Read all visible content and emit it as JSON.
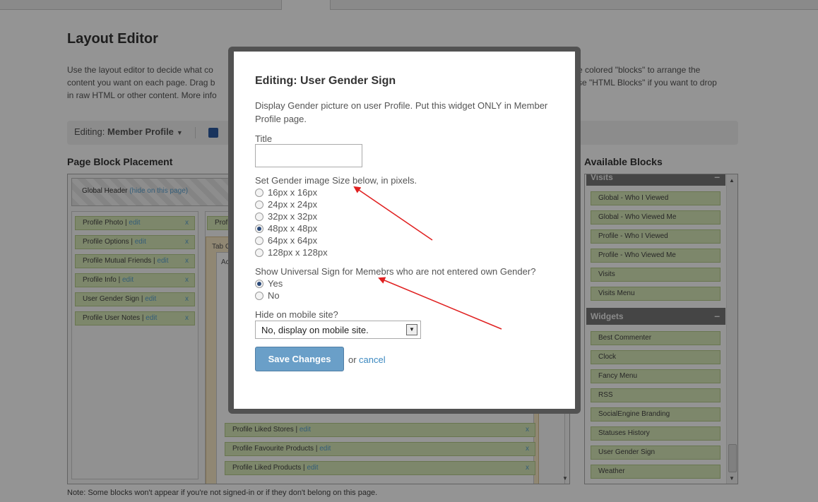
{
  "page": {
    "title": "Layout Editor",
    "intro_line1": "Use the layout editor to decide what co",
    "intro_line1b": "e colored \"blocks\" to arrange the",
    "intro_line2": "content you want on each page. Drag b",
    "intro_line2b": "se \"HTML Blocks\" if you want to drop",
    "intro_line3": "in raw HTML or other content. More info",
    "editing_prefix": "Editing:",
    "editing_page": "Member Profile",
    "placement_title": "Page Block Placement",
    "available_title": "Available Blocks",
    "note": "Note: Some blocks won't appear if you're not signed-in or if they don't belong on this page."
  },
  "placement": {
    "global_header": "Global Header",
    "hide_link": "(hide on this page)",
    "left_blocks": [
      {
        "name": "Profile Photo",
        "edit": "edit"
      },
      {
        "name": "Profile Options",
        "edit": "edit"
      },
      {
        "name": "Profile Mutual Friends",
        "edit": "edit"
      },
      {
        "name": "Profile Info",
        "edit": "edit"
      },
      {
        "name": "User Gender Sign",
        "edit": "edit"
      },
      {
        "name": "Profile User Notes",
        "edit": "edit"
      }
    ],
    "main_top_block": "Profil",
    "tab_container_label": "Tab C",
    "inner_label": "Ac",
    "main_blocks": [
      {
        "name": "Profile Liked Stores",
        "edit": "edit"
      },
      {
        "name": "Profile Favourite Products",
        "edit": "edit"
      },
      {
        "name": "Profile Liked Products",
        "edit": "edit"
      }
    ],
    "remove": "x"
  },
  "available": {
    "visits_group": "Visits",
    "visits_items": [
      "Global - Who I Viewed",
      "Global - Who Viewed Me",
      "Profile - Who I Viewed",
      "Profile - Who Viewed Me",
      "Visits",
      "Visits Menu"
    ],
    "widgets_group": "Widgets",
    "widgets_items": [
      "Best Commenter",
      "Clock",
      "Fancy Menu",
      "RSS",
      "SocialEngine Branding",
      "Statuses History",
      "User Gender Sign",
      "Weather"
    ],
    "collapse": "–"
  },
  "modal": {
    "title": "Editing: User Gender Sign",
    "description": "Display Gender picture on user Profile. Put this widget ONLY in Member Profile page.",
    "title_label": "Title",
    "title_value": "",
    "size_label": "Set Gender image Size below, in pixels.",
    "size_options": [
      "16px x 16px",
      "24px x 24px",
      "32px x 32px",
      "48px x 48px",
      "64px x 64px",
      "128px x 128px"
    ],
    "size_selected": "48px x 48px",
    "universal_label": "Show Universal Sign for Memebrs who are not entered own Gender?",
    "universal_options": [
      "Yes",
      "No"
    ],
    "universal_selected": "Yes",
    "mobile_label": "Hide on mobile site?",
    "mobile_value": "No, display on mobile site.",
    "save_label": "Save Changes",
    "or_text": "or",
    "cancel_label": "cancel"
  },
  "colors": {
    "annotation_arrow": "#e02020",
    "save_button": "#6a9fc8",
    "block_green": "#d8e8b8"
  }
}
